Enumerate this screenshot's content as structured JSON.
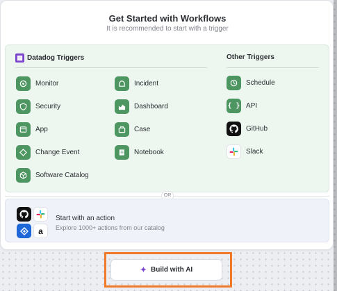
{
  "header": {
    "title": "Get Started with Workflows",
    "subtitle": "It is recommended to start with a trigger"
  },
  "datadog_triggers": {
    "heading": "Datadog Triggers",
    "items": [
      {
        "label": "Monitor",
        "icon": "monitor-icon"
      },
      {
        "label": "Incident",
        "icon": "incident-icon"
      },
      {
        "label": "Security",
        "icon": "security-icon"
      },
      {
        "label": "Dashboard",
        "icon": "dashboard-icon"
      },
      {
        "label": "App",
        "icon": "app-icon"
      },
      {
        "label": "Case",
        "icon": "case-icon"
      },
      {
        "label": "Change Event",
        "icon": "change-event-icon"
      },
      {
        "label": "Notebook",
        "icon": "notebook-icon"
      },
      {
        "label": "Software Catalog",
        "icon": "software-catalog-icon"
      }
    ]
  },
  "other_triggers": {
    "heading": "Other Triggers",
    "items": [
      {
        "label": "Schedule",
        "icon": "schedule-icon"
      },
      {
        "label": "API",
        "icon": "api-icon"
      },
      {
        "label": "GitHub",
        "icon": "github-icon"
      },
      {
        "label": "Slack",
        "icon": "slack-icon"
      }
    ]
  },
  "separator": {
    "label": "OR"
  },
  "action": {
    "title": "Start with an action",
    "subtitle": "Explore 1000+ actions from our catalog",
    "icons": [
      "github-icon",
      "slack-icon",
      "jira-icon",
      "amazon-icon"
    ]
  },
  "ai_button": {
    "label": "Build with AI",
    "icon": "sparkle-icon"
  },
  "colors": {
    "accent_green": "#4d9661",
    "trigger_panel_bg": "#edf6ef",
    "action_panel_bg": "#eff2f9",
    "highlight": "#f0792b",
    "brand_purple": "#7a44cc"
  }
}
